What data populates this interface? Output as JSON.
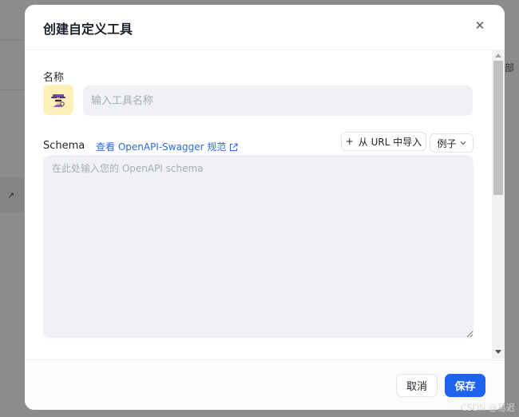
{
  "background": {
    "right_text": "部",
    "left_icon": "arrow-up-right-icon"
  },
  "dialog": {
    "title": "创建自定义工具",
    "close_icon": "close-icon"
  },
  "form": {
    "name_label": "名称",
    "avatar_icon": "detective-emoji-icon",
    "name_placeholder": "输入工具名称",
    "name_value": "",
    "schema_label": "Schema",
    "schema_link_text": "查看 OpenAPI-Swagger 规范",
    "import_button": {
      "icon": "+",
      "label": "从 URL 中导入"
    },
    "example_button": {
      "label": "例子",
      "icon": "chevron-down-icon"
    },
    "schema_placeholder": "在此处输入您的 OpenAPI schema",
    "schema_value": ""
  },
  "footer": {
    "cancel_label": "取消",
    "save_label": "保存"
  },
  "watermark": "CSDN @易迟",
  "colors": {
    "primary": "#1d63ee",
    "link": "#2d6ae3",
    "avatar_bg": "#fdf0b8",
    "input_bg": "#eff1f4"
  }
}
